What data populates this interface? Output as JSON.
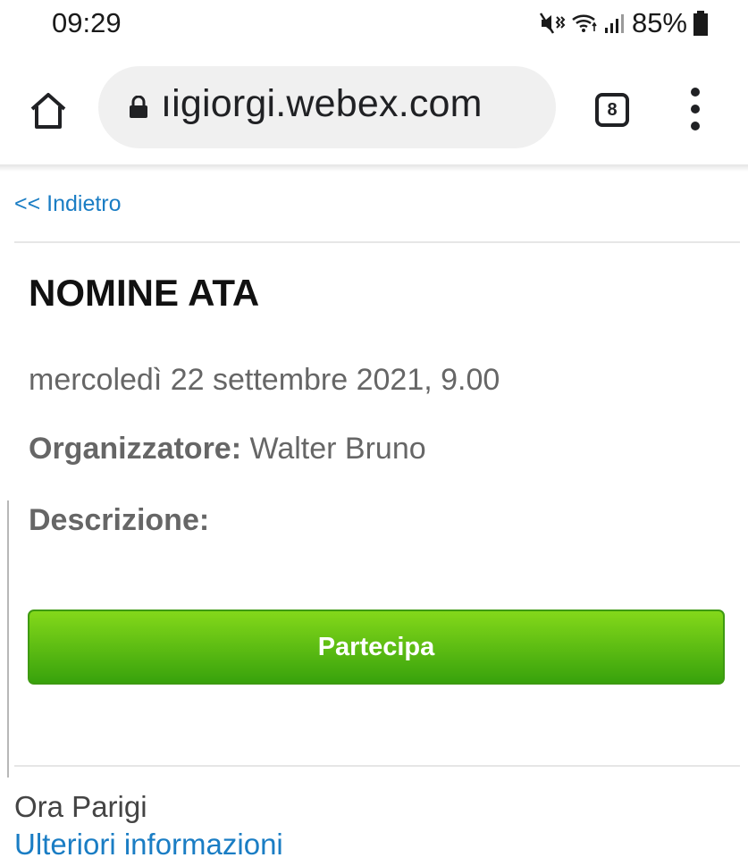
{
  "status_bar": {
    "time": "09:29",
    "battery": "85%",
    "icons": [
      "mute-vibrate-icon",
      "wifi-icon",
      "signal-icon",
      "battery-icon"
    ]
  },
  "browser": {
    "url": "ıigiorgi.webex.com",
    "tab_count": "8",
    "icons": [
      "home-icon",
      "lock-icon",
      "tabs-icon",
      "more-menu-icon"
    ]
  },
  "page": {
    "back_link": "<< Indietro",
    "title": "NOMINE ATA",
    "date": "mercoledì 22 settembre 2021, 9.00",
    "organizer_label": "Organizzatore:",
    "organizer_name": " Walter Bruno",
    "description_label": "Descrizione:",
    "join_button": "Partecipa",
    "timezone": "Ora Parigi",
    "more_info_link": "Ulteriori informazioni"
  },
  "colors": {
    "link": "#1a7dc4",
    "button_top": "#84d81a",
    "button_bottom": "#38a20c"
  }
}
